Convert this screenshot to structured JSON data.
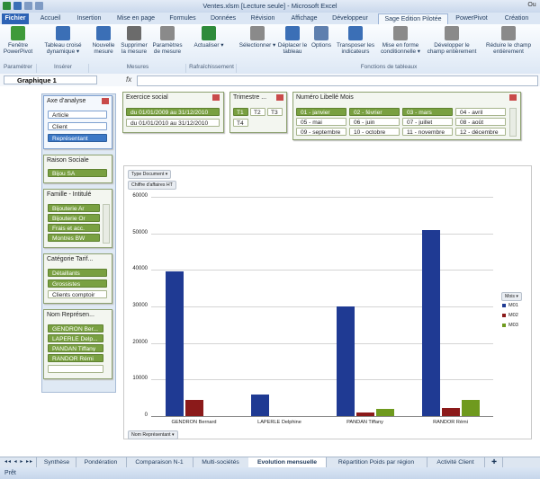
{
  "window": {
    "title": "Ventes.xlsm  [Lecture seule]  -  Microsoft Excel",
    "corner_button": "Ou"
  },
  "tabs": [
    "Fichier",
    "Accueil",
    "Insertion",
    "Mise en page",
    "Formules",
    "Données",
    "Révision",
    "Affichage",
    "Développeur",
    "Sage Edition Pilotée",
    "PowerPivot",
    "Création"
  ],
  "ribbon": {
    "buttons": [
      {
        "label": "Fenêtre PowerPivot",
        "icon": "powerpivot-window-icon",
        "color": "#3f9a3a"
      },
      {
        "label": "Tableau croisé dynamique ▾",
        "icon": "pivot-table-icon",
        "color": "#3b6fb6"
      },
      {
        "label": "Nouvelle mesure",
        "icon": "new-measure-icon",
        "color": "#3b6fb6"
      },
      {
        "label": "Supprimer la mesure",
        "icon": "delete-measure-icon",
        "color": "#6b6b6b"
      },
      {
        "label": "Paramètres de mesure",
        "icon": "measure-settings-icon",
        "color": "#8a8a8a"
      },
      {
        "label": "Actualiser ▾",
        "icon": "refresh-icon",
        "color": "#2e8b3a"
      },
      {
        "label": "Sélectionner ▾",
        "icon": "select-icon",
        "color": "#8a8a8a"
      },
      {
        "label": "Déplacer le tableau",
        "icon": "move-table-icon",
        "color": "#3b6fb6"
      },
      {
        "label": "Options",
        "icon": "options-icon",
        "color": "#5e7fae"
      },
      {
        "label": "Transposer les indicateurs",
        "icon": "transpose-icon",
        "color": "#3b6fb6"
      },
      {
        "label": "Mise en forme conditionnelle ▾",
        "icon": "conditional-format-icon",
        "color": "#8a8a8a"
      },
      {
        "label": "Développer le champ entièrement",
        "icon": "expand-field-icon",
        "color": "#8a8a8a"
      },
      {
        "label": "Réduire le champ entièrement",
        "icon": "collapse-field-icon",
        "color": "#8a8a8a"
      }
    ],
    "groups": [
      "Paramétrer",
      "Insérer",
      "Mesures",
      "Rafraîchissement",
      "Fonctions de tableaux"
    ]
  },
  "formula_bar": {
    "name_box": "Graphique 1",
    "fx": "fx",
    "value": ""
  },
  "slicers": {
    "axe": {
      "title": "Axe d'analyse",
      "items": [
        {
          "label": "Article",
          "selected": false
        },
        {
          "label": "Client",
          "selected": false
        },
        {
          "label": "Représentant",
          "selected": true
        }
      ]
    },
    "exercice": {
      "title": "Exercice social",
      "items": [
        {
          "label": "du 01/01/2009 au 31/12/2010",
          "selected": true
        },
        {
          "label": "du 01/01/2010 au 31/12/2010",
          "selected": false
        }
      ]
    },
    "trimestre": {
      "title": "Trimestre ...",
      "items": [
        {
          "label": "T1",
          "selected": true
        },
        {
          "label": "T2",
          "selected": false
        },
        {
          "label": "T3",
          "selected": false
        },
        {
          "label": "T4",
          "selected": false
        }
      ]
    },
    "mois": {
      "title": "Numéro Libellé Mois",
      "items": [
        {
          "label": "01 - janvier",
          "selected": true
        },
        {
          "label": "02 - février",
          "selected": true
        },
        {
          "label": "03 - mars",
          "selected": true
        },
        {
          "label": "04 - avril",
          "selected": false
        },
        {
          "label": "05 - mai",
          "selected": false
        },
        {
          "label": "06 - juin",
          "selected": false
        },
        {
          "label": "07 - juillet",
          "selected": false
        },
        {
          "label": "08 - août",
          "selected": false
        },
        {
          "label": "09 - septembre",
          "selected": false
        },
        {
          "label": "10 - octobre",
          "selected": false
        },
        {
          "label": "11 - novembre",
          "selected": false
        },
        {
          "label": "12 - décembre",
          "selected": false
        }
      ]
    },
    "raison": {
      "title": "Raison Sociale",
      "items": [
        {
          "label": "Bijou SA",
          "selected": true
        }
      ]
    },
    "famille": {
      "title": "Famille - Intitulé",
      "items": [
        {
          "label": "Bijouterie Ar",
          "selected": true
        },
        {
          "label": "Bijouterie Or",
          "selected": true
        },
        {
          "label": "Frais et acc.",
          "selected": true
        },
        {
          "label": "Montres BW",
          "selected": true
        }
      ]
    },
    "categorie": {
      "title": "Catégorie Tarif...",
      "items": [
        {
          "label": "Détaillants",
          "selected": true
        },
        {
          "label": "Grossistes",
          "selected": true
        },
        {
          "label": "Clients comptoir",
          "selected": false
        }
      ]
    },
    "nom": {
      "title": "Nom Représen...",
      "items": [
        {
          "label": "GENDRON Ber...",
          "selected": true
        },
        {
          "label": "LAPERLE Delp...",
          "selected": true
        },
        {
          "label": "PANDAN Tiffany",
          "selected": true
        },
        {
          "label": "RANDOR Rémi",
          "selected": true
        }
      ]
    }
  },
  "chart_field_buttons": {
    "type_document": "Type Document",
    "measure": "Chiffre d'affaires HT",
    "axis": "Nom Représentant",
    "legend": "Mois"
  },
  "chart_data": {
    "type": "bar",
    "categories": [
      "GENDRON Bernard",
      "LAPERLE Delphine",
      "PANDAN Tiffany",
      "RANDOR Rémi"
    ],
    "series": [
      {
        "name": "M01",
        "color": "#1f3a93",
        "values": [
          39500,
          5800,
          30000,
          51000
        ]
      },
      {
        "name": "M02",
        "color": "#8b1a1a",
        "values": [
          4500,
          0,
          1000,
          2300
        ]
      },
      {
        "name": "M03",
        "color": "#6f9a1e",
        "values": [
          0,
          0,
          2000,
          4500
        ]
      }
    ],
    "ylim": [
      0,
      60000
    ],
    "yticks": [
      "0",
      "10000",
      "20000",
      "30000",
      "40000",
      "50000",
      "60000"
    ],
    "legend_position": "right",
    "grid": true
  },
  "sheet_tabs": {
    "items": [
      "Synthèse",
      "Pondération",
      "Comparaison N-1",
      "Multi-sociétés",
      "Evolution mensuelle",
      "Répartition Poids par région",
      "Activité Client"
    ],
    "active": "Evolution mensuelle"
  },
  "status": {
    "text": "Prêt"
  }
}
